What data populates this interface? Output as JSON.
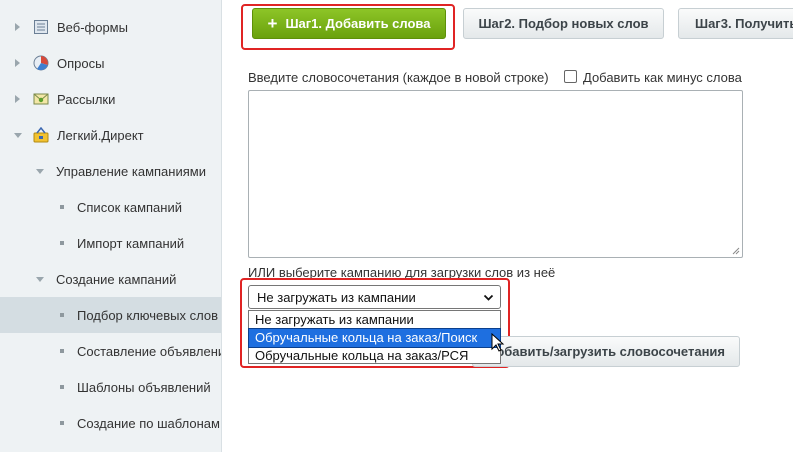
{
  "sidebar": {
    "items": [
      {
        "label": "Веб-формы",
        "icon": "form-icon"
      },
      {
        "label": "Опросы",
        "icon": "poll-icon"
      },
      {
        "label": "Рассылки",
        "icon": "mail-icon"
      },
      {
        "label": "Легкий.Директ",
        "icon": "direct-icon"
      },
      {
        "label": "Управление кампаниями"
      },
      {
        "label": "Список кампаний"
      },
      {
        "label": "Импорт кампаний"
      },
      {
        "label": "Создание кампаний"
      },
      {
        "label": "Подбор ключевых слов"
      },
      {
        "label": "Составление объявлений"
      },
      {
        "label": "Шаблоны объявлений"
      },
      {
        "label": "Создание по шаблонам"
      }
    ]
  },
  "steps": {
    "step1": "Шаг1. Добавить слова",
    "step1_icon": "+",
    "step2": "Шаг2. Подбор новых слов",
    "step3": "Шаг3. Получить"
  },
  "form": {
    "textarea_label": "Введите словосочетания (каждое в новой строке)",
    "minus_checkbox_label": "Добавить как минус слова",
    "minus_checked": false,
    "textarea_value": "",
    "campaign_label": "ИЛИ выберите кампанию для загрузки слов из неё",
    "select_value": "Не загружать из кампании",
    "options": [
      "Не загружать из кампании",
      "Обручальные кольца на заказ/Поиск",
      "Обручальные кольца на заказ/РСЯ"
    ],
    "highlighted_option": 1,
    "submit_button": "Добавить/загрузить словосочетания"
  },
  "colors": {
    "accent_green": "#7ab31a",
    "highlight_red": "#e02424",
    "selection_blue": "#1e6fe0"
  }
}
